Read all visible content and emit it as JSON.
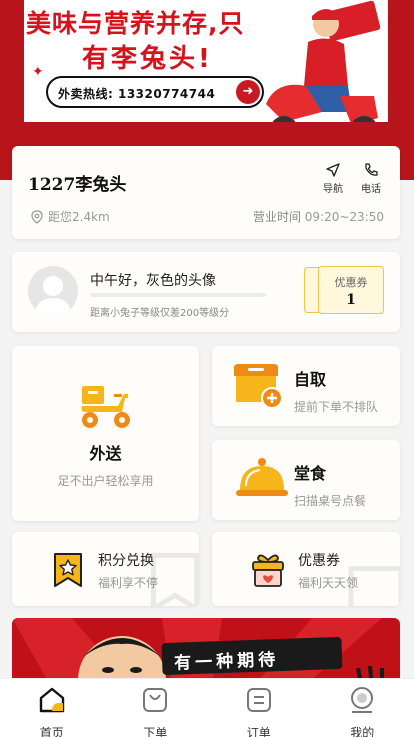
{
  "banner": {
    "headline_line1": "美味与营养并存,只",
    "headline_line2": "有李兔头!",
    "hotline": "外卖热线: 13320774744"
  },
  "store": {
    "name": "1227李兔头",
    "distance": "距您2.4km",
    "hours_label": "营业时间",
    "hours_value": "09:20~23:50",
    "navigate_label": "导航",
    "call_label": "电话"
  },
  "user": {
    "greeting": "中午好，灰色的头像",
    "level_note": "距离小兔子等级仅差200等级分",
    "level_progress": 0.0,
    "coupon_label": "优惠券",
    "coupon_count": "1"
  },
  "services": {
    "delivery": {
      "title": "外送",
      "subtitle": "足不出户轻松享用"
    },
    "pickup": {
      "title": "自取",
      "subtitle": "提前下单不排队"
    },
    "dine_in": {
      "title": "堂食",
      "subtitle": "扫描桌号点餐"
    },
    "points": {
      "title": "积分兑换",
      "subtitle": "福利享不停"
    },
    "coupons": {
      "title": "优惠券",
      "subtitle": "福利天天领"
    }
  },
  "promo": {
    "slogan": "有一种期待"
  },
  "tabbar": {
    "items": [
      {
        "label": "首页",
        "icon": "home-icon",
        "active": true
      },
      {
        "label": "下单",
        "icon": "shopping-bag-icon",
        "active": false
      },
      {
        "label": "订单",
        "icon": "order-list-icon",
        "active": false
      },
      {
        "label": "我的",
        "icon": "profile-icon",
        "active": false
      }
    ]
  },
  "colors": {
    "brand_red": "#b8141b",
    "accent_yellow": "#f5b51b",
    "accent_orange": "#f08a17"
  }
}
